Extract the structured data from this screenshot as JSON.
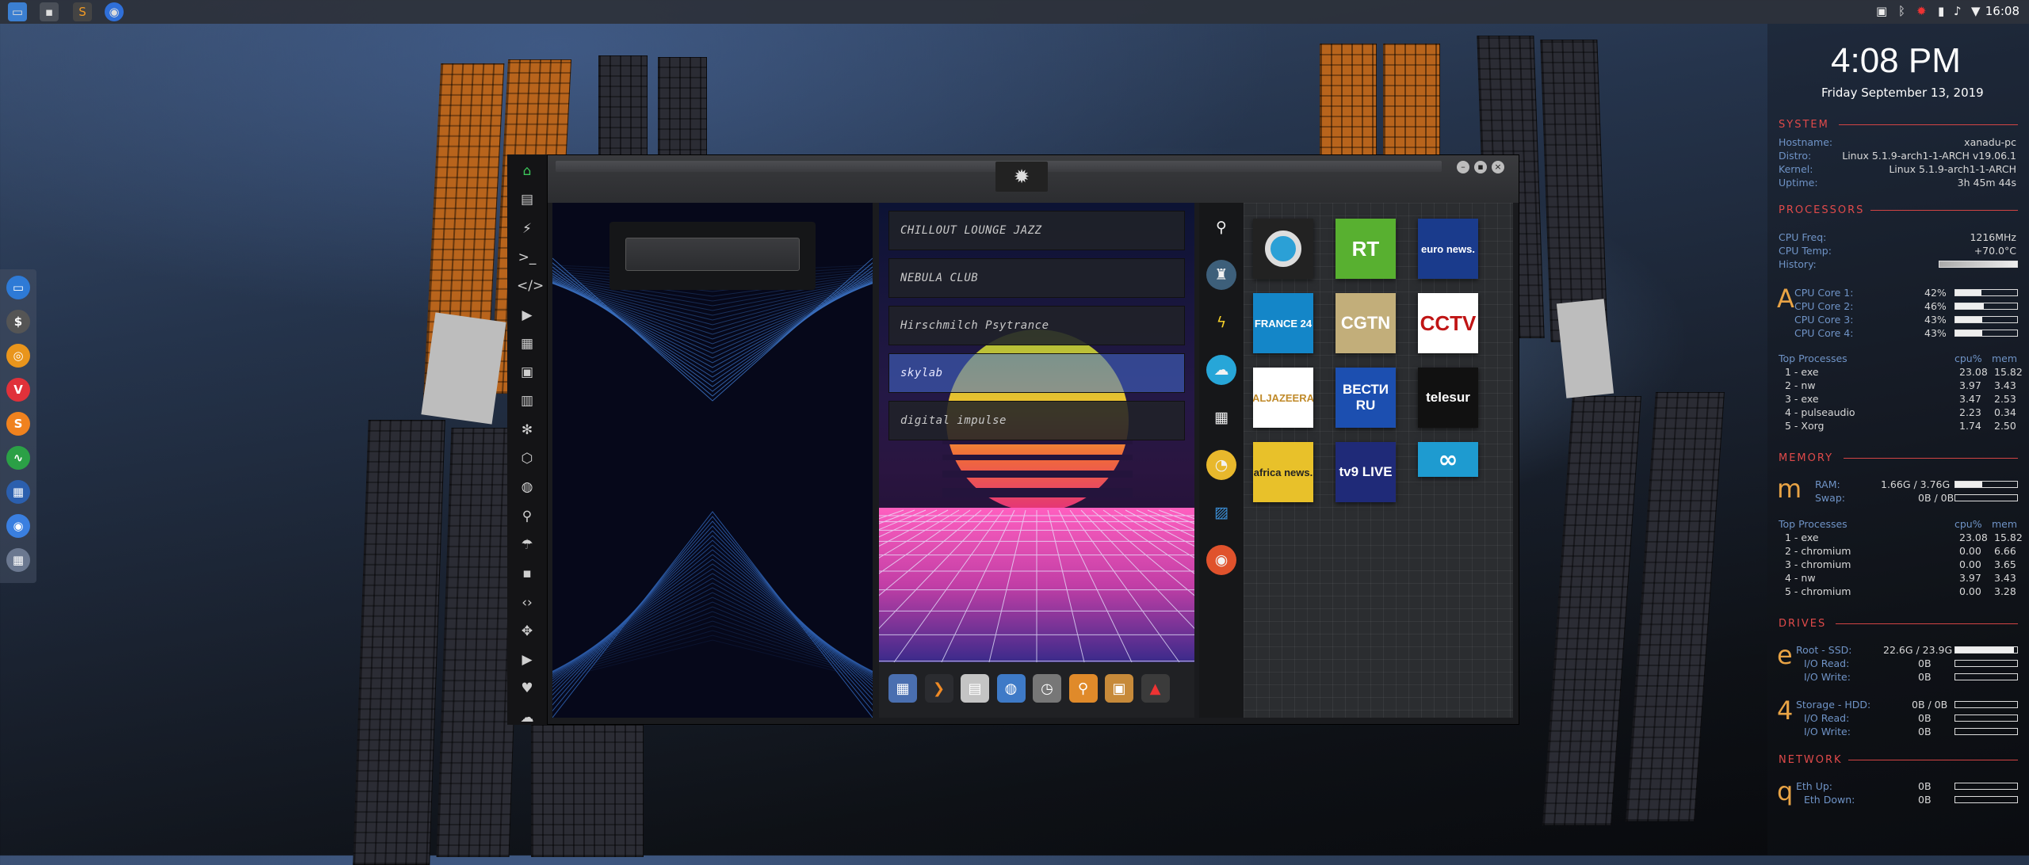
{
  "topbar": {
    "clock": "16:08",
    "apps": [
      "files-icon",
      "terminal-icon",
      "sublime-icon",
      "chromium-icon"
    ],
    "tray": [
      "screenshot-icon",
      "bluetooth-icon",
      "settings-icon",
      "battery-icon",
      "volume-icon",
      "wifi-icon"
    ]
  },
  "dock": {
    "items": [
      "files-icon",
      "money-icon",
      "ubuntu-icon",
      "vivaldi-icon",
      "sublime-icon",
      "monitor-icon",
      "network-icon",
      "chromium-icon",
      "globe-icon"
    ]
  },
  "conky": {
    "time": "4:08 PM",
    "date": "Friday September 13, 2019",
    "system": {
      "heading": "SYSTEM",
      "rows": [
        {
          "label": "Hostname:",
          "value": "xanadu-pc"
        },
        {
          "label": "Distro:",
          "value": "Linux 5.1.9-arch1-1-ARCH v19.06.1"
        },
        {
          "label": "Kernel:",
          "value": "Linux 5.1.9-arch1-1-ARCH"
        },
        {
          "label": "Uptime:",
          "value": "3h 45m 44s"
        }
      ]
    },
    "processors": {
      "heading": "PROCESSORS",
      "freq_label": "CPU Freq:",
      "freq": "1216MHz",
      "temp_label": "CPU Temp:",
      "temp": "+70.0°C",
      "history_label": "History:",
      "big": "A",
      "cores": [
        {
          "label": "CPU Core 1:",
          "value": "42%",
          "pct": 0.42
        },
        {
          "label": "CPU Core 2:",
          "value": "46%",
          "pct": 0.46
        },
        {
          "label": "CPU Core 3:",
          "value": "43%",
          "pct": 0.43
        },
        {
          "label": "CPU Core 4:",
          "value": "43%",
          "pct": 0.43
        }
      ],
      "top_label": "Top Processes",
      "col_cpu": "cpu%",
      "col_mem": "mem",
      "top": [
        {
          "name": "1 - exe",
          "cpu": "23.08",
          "mem": "15.82"
        },
        {
          "name": "2 - nw",
          "cpu": "3.97",
          "mem": "3.43"
        },
        {
          "name": "3 - exe",
          "cpu": "3.47",
          "mem": "2.53"
        },
        {
          "name": "4 - pulseaudio",
          "cpu": "2.23",
          "mem": "0.34"
        },
        {
          "name": "5 - Xorg",
          "cpu": "1.74",
          "mem": "2.50"
        }
      ]
    },
    "memory": {
      "heading": "MEMORY",
      "big": "m",
      "ram_label": "RAM:",
      "ram": "1.66G / 3.76G",
      "ram_pct": 0.44,
      "swap_label": "Swap:",
      "swap": "0B / 0B",
      "top_label": "Top Processes",
      "col_cpu": "cpu%",
      "col_mem": "mem",
      "top": [
        {
          "name": "1 - exe",
          "cpu": "23.08",
          "mem": "15.82"
        },
        {
          "name": "2 - chromium",
          "cpu": "0.00",
          "mem": "6.66"
        },
        {
          "name": "3 - chromium",
          "cpu": "0.00",
          "mem": "3.65"
        },
        {
          "name": "4 - nw",
          "cpu": "3.97",
          "mem": "3.43"
        },
        {
          "name": "5 - chromium",
          "cpu": "0.00",
          "mem": "3.28"
        }
      ]
    },
    "drives": {
      "heading": "DRIVES",
      "root": {
        "big": "e",
        "label": "Root  -  SSD:",
        "value": "22.6G / 23.9G",
        "pct": 0.95,
        "read_label": "I/O Read:",
        "read": "0B",
        "write_label": "I/O Write:",
        "write": "0B"
      },
      "storage": {
        "big": "4",
        "label": "Storage  -  HDD:",
        "value": "0B / 0B",
        "read_label": "I/O Read:",
        "read": "0B",
        "write_label": "I/O Write:",
        "write": "0B"
      }
    },
    "network": {
      "heading": "NETWORK",
      "big": "q",
      "up_label": "Eth Up:",
      "up": "0B",
      "down_label": "Eth Down:",
      "down": "0B"
    }
  },
  "window": {
    "emblem_icon": "rebel-alliance-icon",
    "search_value": "",
    "sidebar": [
      "home-icon",
      "document-icon",
      "bolt-icon",
      "terminal-icon",
      "code-icon",
      "play-icon",
      "images-icon",
      "image-icon",
      "news-icon",
      "settings-icon",
      "hexagon-icon",
      "globe-icon",
      "search-icon",
      "umbrella-icon",
      "contact-icon",
      "code-brackets-icon",
      "expand-icon",
      "youtube-icon",
      "heart-icon",
      "cloud-icon"
    ],
    "stations": [
      "CHILLOUT LOUNGE JAZZ",
      "NEBULA CLUB",
      "Hirschmilch Psytrance",
      "skylab",
      "digital impulse"
    ],
    "active_station": 3,
    "launcher": [
      "calculator-icon",
      "terminal-icon",
      "calendar-icon",
      "globe-icon",
      "clock-icon",
      "search-icon",
      "image-viewer-icon",
      "pdf-icon"
    ],
    "categories": [
      "search-icon",
      "radio-tower-icon",
      "pikachu-icon",
      "cloud-upload-icon",
      "film-icon",
      "satellite-dish-icon",
      "blueprint-icon",
      "podcast-icon"
    ],
    "channels": [
      {
        "name": "dw-logo",
        "text": "",
        "bg": "#222"
      },
      {
        "name": "rt-logo",
        "text": "RT",
        "bg": "#58b030"
      },
      {
        "name": "euronews-logo",
        "text": "euro news.",
        "bg": "#1a3b8c"
      },
      {
        "name": "france24-logo",
        "text": "FRANCE 24",
        "bg": "#1486c8"
      },
      {
        "name": "cgtn-logo",
        "text": "CGTN",
        "bg": "#c2ae7a"
      },
      {
        "name": "cctv-logo",
        "text": "CCTV",
        "bg": "#ffffff"
      },
      {
        "name": "aljazeera-logo",
        "text": "ALJAZEERA",
        "bg": "#ffffff"
      },
      {
        "name": "vesti-logo",
        "text": "ВЕСТИ RU",
        "bg": "#1c4fb0"
      },
      {
        "name": "telesur-logo",
        "text": "telesur",
        "bg": "#111"
      },
      {
        "name": "africanews-logo",
        "text": "africa news.",
        "bg": "#e8c12a"
      },
      {
        "name": "tv9-logo",
        "text": "tv9 LIVE",
        "bg": "#1f2a78"
      },
      {
        "name": "abc-logo",
        "text": "",
        "bg": "#1e9bd0"
      }
    ]
  }
}
